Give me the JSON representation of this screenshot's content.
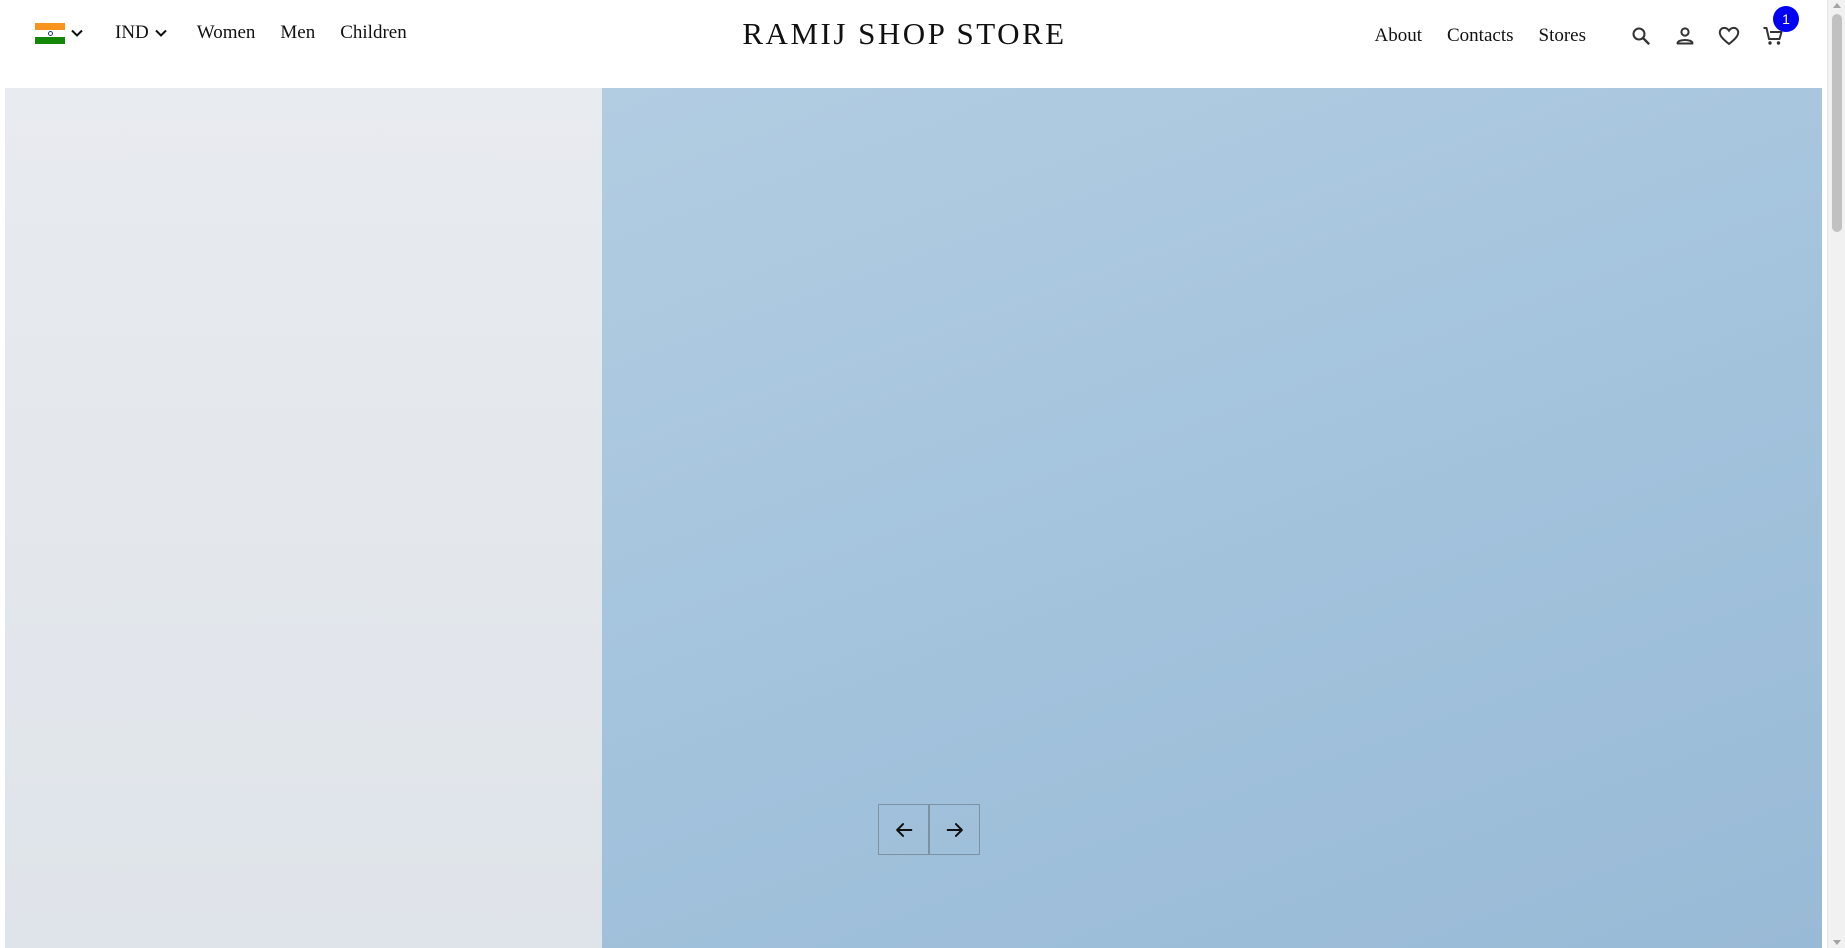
{
  "header": {
    "country_flag_icon": "india-flag-icon",
    "currency": "IND",
    "left_links": [
      "Women",
      "Men",
      "Children"
    ],
    "brand": "RAMIJ SHOP STORE",
    "right_links": [
      "About",
      "Contacts",
      "Stores"
    ],
    "icons": [
      "search-icon",
      "user-icon",
      "heart-icon",
      "cart-icon"
    ],
    "cart_count": "1",
    "cart_badge_color": "#0000f5"
  },
  "hero": {
    "image_subject": "hero-photo",
    "prev_icon": "arrow-left-icon",
    "next_icon": "arrow-right-icon",
    "colors": {
      "left_wall": "#e3e7ec",
      "right_wall": "#a3c3dc"
    }
  }
}
